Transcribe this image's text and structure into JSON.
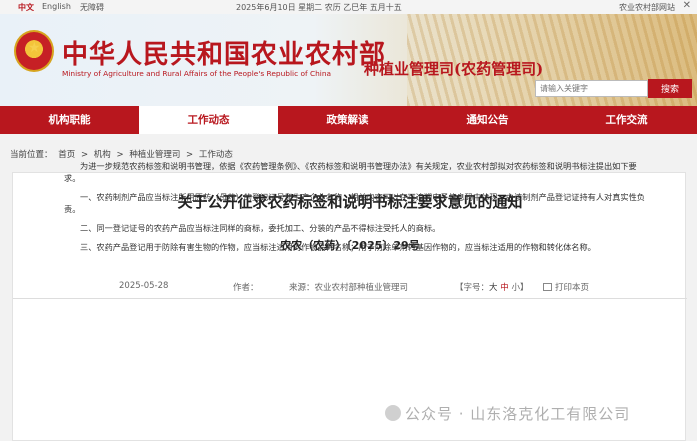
{
  "topbar": {
    "lang_cn": "中文",
    "lang_en": "English",
    "accessibility": "无障碍",
    "date": "2025年6月10日 星期二 农历 乙巳年 五月十五",
    "site_name": "农业农村部网站",
    "close_icon": "close-icon"
  },
  "header": {
    "emblem_icon": "national-emblem-icon",
    "title_cn": "中华人民共和国农业农村部",
    "title_en": "Ministry of Agriculture and Rural Affairs of the People's Republic of China",
    "department": "种植业管理司(农药管理司)",
    "search_placeholder": "请输入关键字",
    "search_button": "搜索"
  },
  "nav": {
    "items": [
      "机构职能",
      "工作动态",
      "政策解读",
      "通知公告",
      "工作交流"
    ],
    "active_index": 1
  },
  "breadcrumb": {
    "prefix": "当前位置：",
    "items": [
      "首页",
      "机构",
      "种植业管理司",
      "工作动态"
    ],
    "separator": ">"
  },
  "article": {
    "title": "关于公开征求农药标签和说明书标注要求意见的通知",
    "doc_number": "农农（农药）〔2025〕29号",
    "date": "2025-05-28",
    "author_label": "作者：",
    "source_label": "来源：",
    "source": "农业农村部种植业管理司",
    "font_label": "【字号：",
    "font_big": "大",
    "font_mid": "中",
    "font_small": "小",
    "font_close": "】",
    "print_label": "打印本页",
    "print_icon": "print-icon",
    "paragraphs": [
      "为进一步规范农药标签和说明书管理，依据《农药管理条例》、《农药标签和说明书管理办法》有关规定，农业农村部拟对农药标签和说明书标注提出如下要求。",
      "一、农药制剂产品应当标注所用原药（母药）的登记证号和生产企业名称，相关内容可以在可追溯电子信息码中体现，由该制剂产品登记证持有人对真实性负责。",
      "二、同一登记证号的农药产品应当标注同样的商标，委托加工、分装的产品不得标注受托人的商标。",
      "三、农药产品登记用于防除有害生物的作物，应当标注适用的作物品种名称；用于防除单剂转基因作物的，应当标注适用的作物和转化体名称。"
    ]
  },
  "watermark": {
    "text": "公众号 · 山东洛克化工有限公司",
    "icon": "wechat-icon"
  },
  "colors": {
    "brand_red": "#b8171e",
    "nav_bg": "#b8171e",
    "page_bg": "#f2f2f2"
  }
}
